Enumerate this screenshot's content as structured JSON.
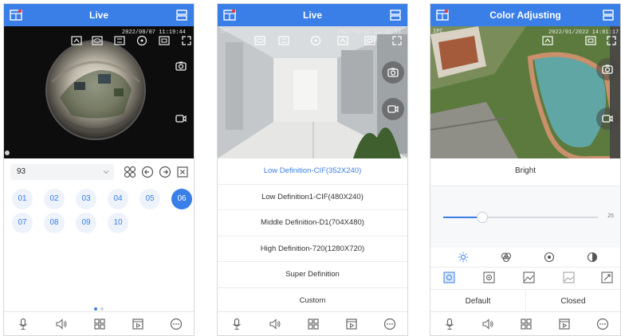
{
  "panels": {
    "live_fisheye": {
      "title": "Live",
      "timestamp": "2022/08/07 11:19:44",
      "channel_select": {
        "value": "93"
      },
      "channel_numbers": [
        "01",
        "02",
        "03",
        "04",
        "05",
        "06",
        "07",
        "08",
        "09",
        "10"
      ],
      "active_channel": "06",
      "page_indicator": {
        "count": 2,
        "current": 0
      }
    },
    "live_quality": {
      "title": "Live",
      "channel_label": "IPC",
      "timestamp": "2022/08/07 11:18:53",
      "quality_options": [
        "Low Definition-CIF(352X240)",
        "Low Definition1-CIF(480X240)",
        "Middle Definition-D1(704X480)",
        "High Definition-720(1280X720)",
        "Super Definition",
        "Custom"
      ],
      "selected_option": "Low Definition-CIF(352X240)"
    },
    "color_adjusting": {
      "title": "Color Adjusting",
      "channel_label": "IPC",
      "timestamp": "2022/01/2022 14:01:17",
      "adjust_label": "Bright",
      "slider": {
        "value": 25,
        "min": 0,
        "max": 100
      },
      "default_label": "Default",
      "closed_label": "Closed"
    }
  },
  "colors": {
    "accent": "#3a7ee8",
    "accent_light": "#eef3fb",
    "text": "#333333",
    "border": "#ececec"
  },
  "icons": {
    "topbar_left": "multi-screen-icon",
    "topbar_right": "menu-list-icon",
    "bottom_bar": [
      "microphone-icon",
      "speaker-icon",
      "grid-icon",
      "playback-icon",
      "more-icon"
    ],
    "video_overlay": [
      "snapshot-icon",
      "record-icon"
    ],
    "adjust_modes": [
      "brightness-icon",
      "contrast-icon",
      "saturation-icon",
      "sharpness-icon"
    ]
  }
}
